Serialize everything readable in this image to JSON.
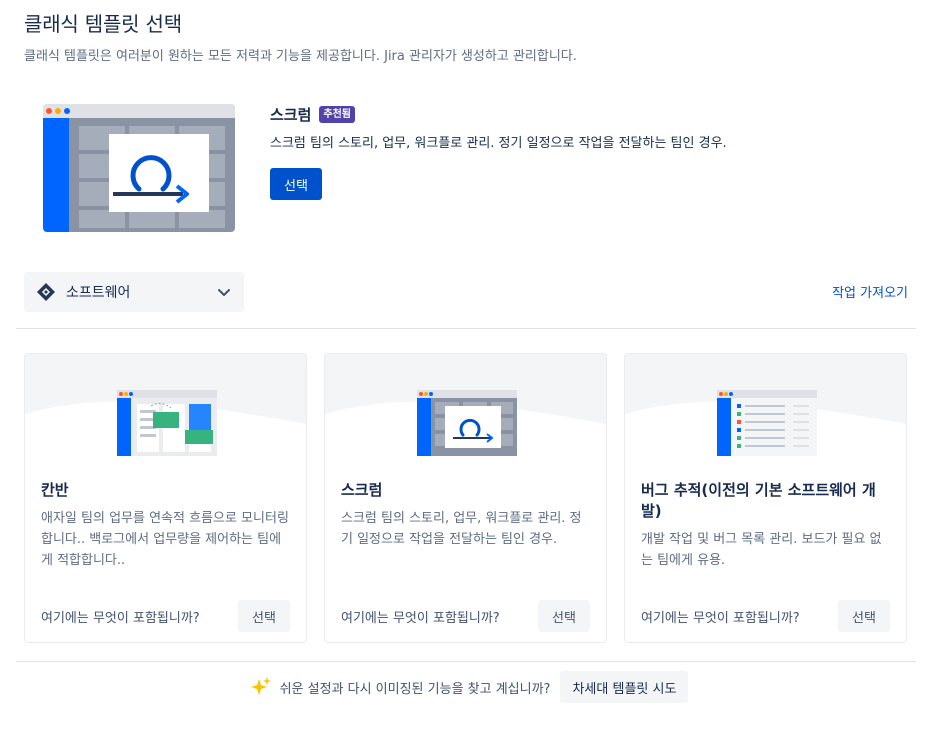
{
  "header": {
    "title": "클래식 템플릿 선택",
    "subtitle": "클래식 템플릿은 여러분이 원하는 모든 저력과 기능을 제공합니다. Jira 관리자가 생성하고 관리합니다."
  },
  "featured": {
    "title": "스크럼",
    "badge": "추천됨",
    "description": "스크럼 팀의 스토리, 업무, 워크플로 관리. 정기 일정으로 작업을 전달하는 팀인 경우.",
    "select_label": "선택",
    "icon": "scrum-loop-icon"
  },
  "filter": {
    "selected": "소프트웨어",
    "icon": "jira-software-icon",
    "import_link": "작업 가져오기"
  },
  "cards": [
    {
      "title": "칸반",
      "description": "애자일 팀의 업무를 연속적 흐름으로 모니터링합니다.. 백로그에서 업무량을 제어하는 팀에게 적합합니다..",
      "info_link": "여기에는 무엇이 포함됩니까?",
      "select_label": "선택"
    },
    {
      "title": "스크럼",
      "description": "스크럼 팀의 스토리, 업무, 워크플로 관리. 정기 일정으로 작업을 전달하는 팀인 경우.",
      "info_link": "여기에는 무엇이 포함됩니까?",
      "select_label": "선택"
    },
    {
      "title": "버그 추적(이전의 기본 소프트웨어 개발)",
      "description": "개발 작업 및 버그 목록 관리. 보드가 필요 없는 팀에게 유용.",
      "info_link": "여기에는 무엇이 포함됩니까?",
      "select_label": "선택"
    }
  ],
  "footer": {
    "text": "쉬운 설정과 다시 이미징된 기능을 찾고 계십니까?",
    "button_label": "차세대 템플릿 시도",
    "icon": "sparkle-icon"
  },
  "colors": {
    "primary": "#0052cc",
    "badge": "#5243aa",
    "text": "#172b4d",
    "subtle_text": "#5e6c84"
  }
}
